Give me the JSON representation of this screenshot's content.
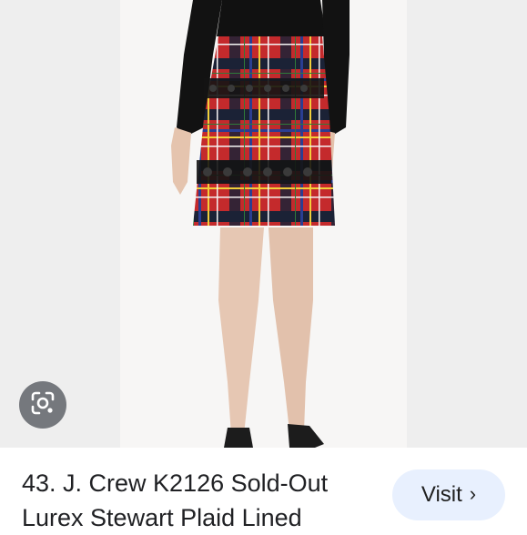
{
  "result": {
    "title_line1": "43. J. Crew K2126 Sold-Out",
    "title_line2": "Lurex Stewart Plaid Lined",
    "visit_label": "Visit",
    "visit_chevron": "›"
  },
  "icons": {
    "lens": "google-lens-icon"
  },
  "colors": {
    "visit_bg": "#e8f0fe",
    "lens_bg": "#5f6368",
    "skirt_red": "#c4262e"
  }
}
